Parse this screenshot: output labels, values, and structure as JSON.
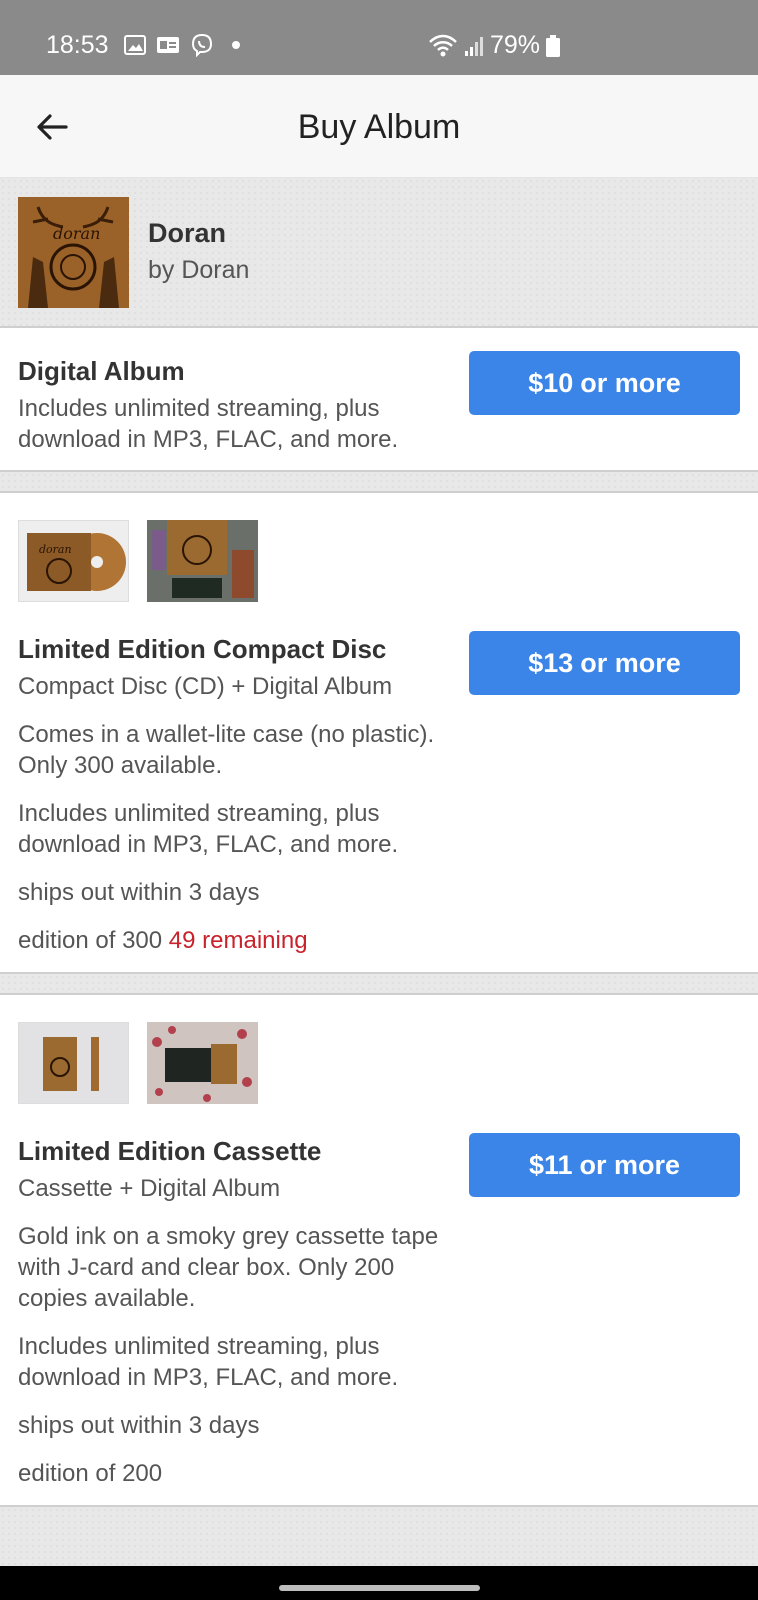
{
  "status_bar": {
    "time": "18:53",
    "battery": "79%",
    "icons": [
      "image-icon",
      "id-card-icon",
      "viber-icon",
      "dot-icon",
      "wifi-icon",
      "signal-icon",
      "battery-icon"
    ]
  },
  "app_bar": {
    "title": "Buy Album",
    "back_icon": "arrow-left-icon"
  },
  "album": {
    "name": "Doran",
    "by": "by Doran"
  },
  "items": [
    {
      "title": "Digital Album",
      "description": "Includes unlimited streaming, plus download in MP3, FLAC, and more.",
      "price_amount": "$10",
      "price_suffix": "or more"
    },
    {
      "title": "Limited Edition Compact Disc",
      "subtitle": "Compact Disc (CD) + Digital Album",
      "details": [
        "Comes in a wallet-lite case (no plastic). Only 300 available.",
        "Includes unlimited streaming, plus download in MP3, FLAC, and more.",
        "ships out within 3 days"
      ],
      "edition": "edition of 300",
      "remaining": "49 remaining",
      "price_amount": "$13",
      "price_suffix": "or more"
    },
    {
      "title": "Limited Edition Cassette",
      "subtitle": "Cassette + Digital Album",
      "details": [
        "Gold ink on a smoky grey cassette tape with J-card and clear box. Only 200 copies available.",
        "Includes unlimited streaming, plus download in MP3, FLAC, and more.",
        "ships out within 3 days"
      ],
      "edition": "edition of 200",
      "price_amount": "$11",
      "price_suffix": "or more"
    }
  ],
  "colors": {
    "button": "#3b85e8",
    "remaining": "#c8232c",
    "status_bar": "#8a8a8a"
  }
}
